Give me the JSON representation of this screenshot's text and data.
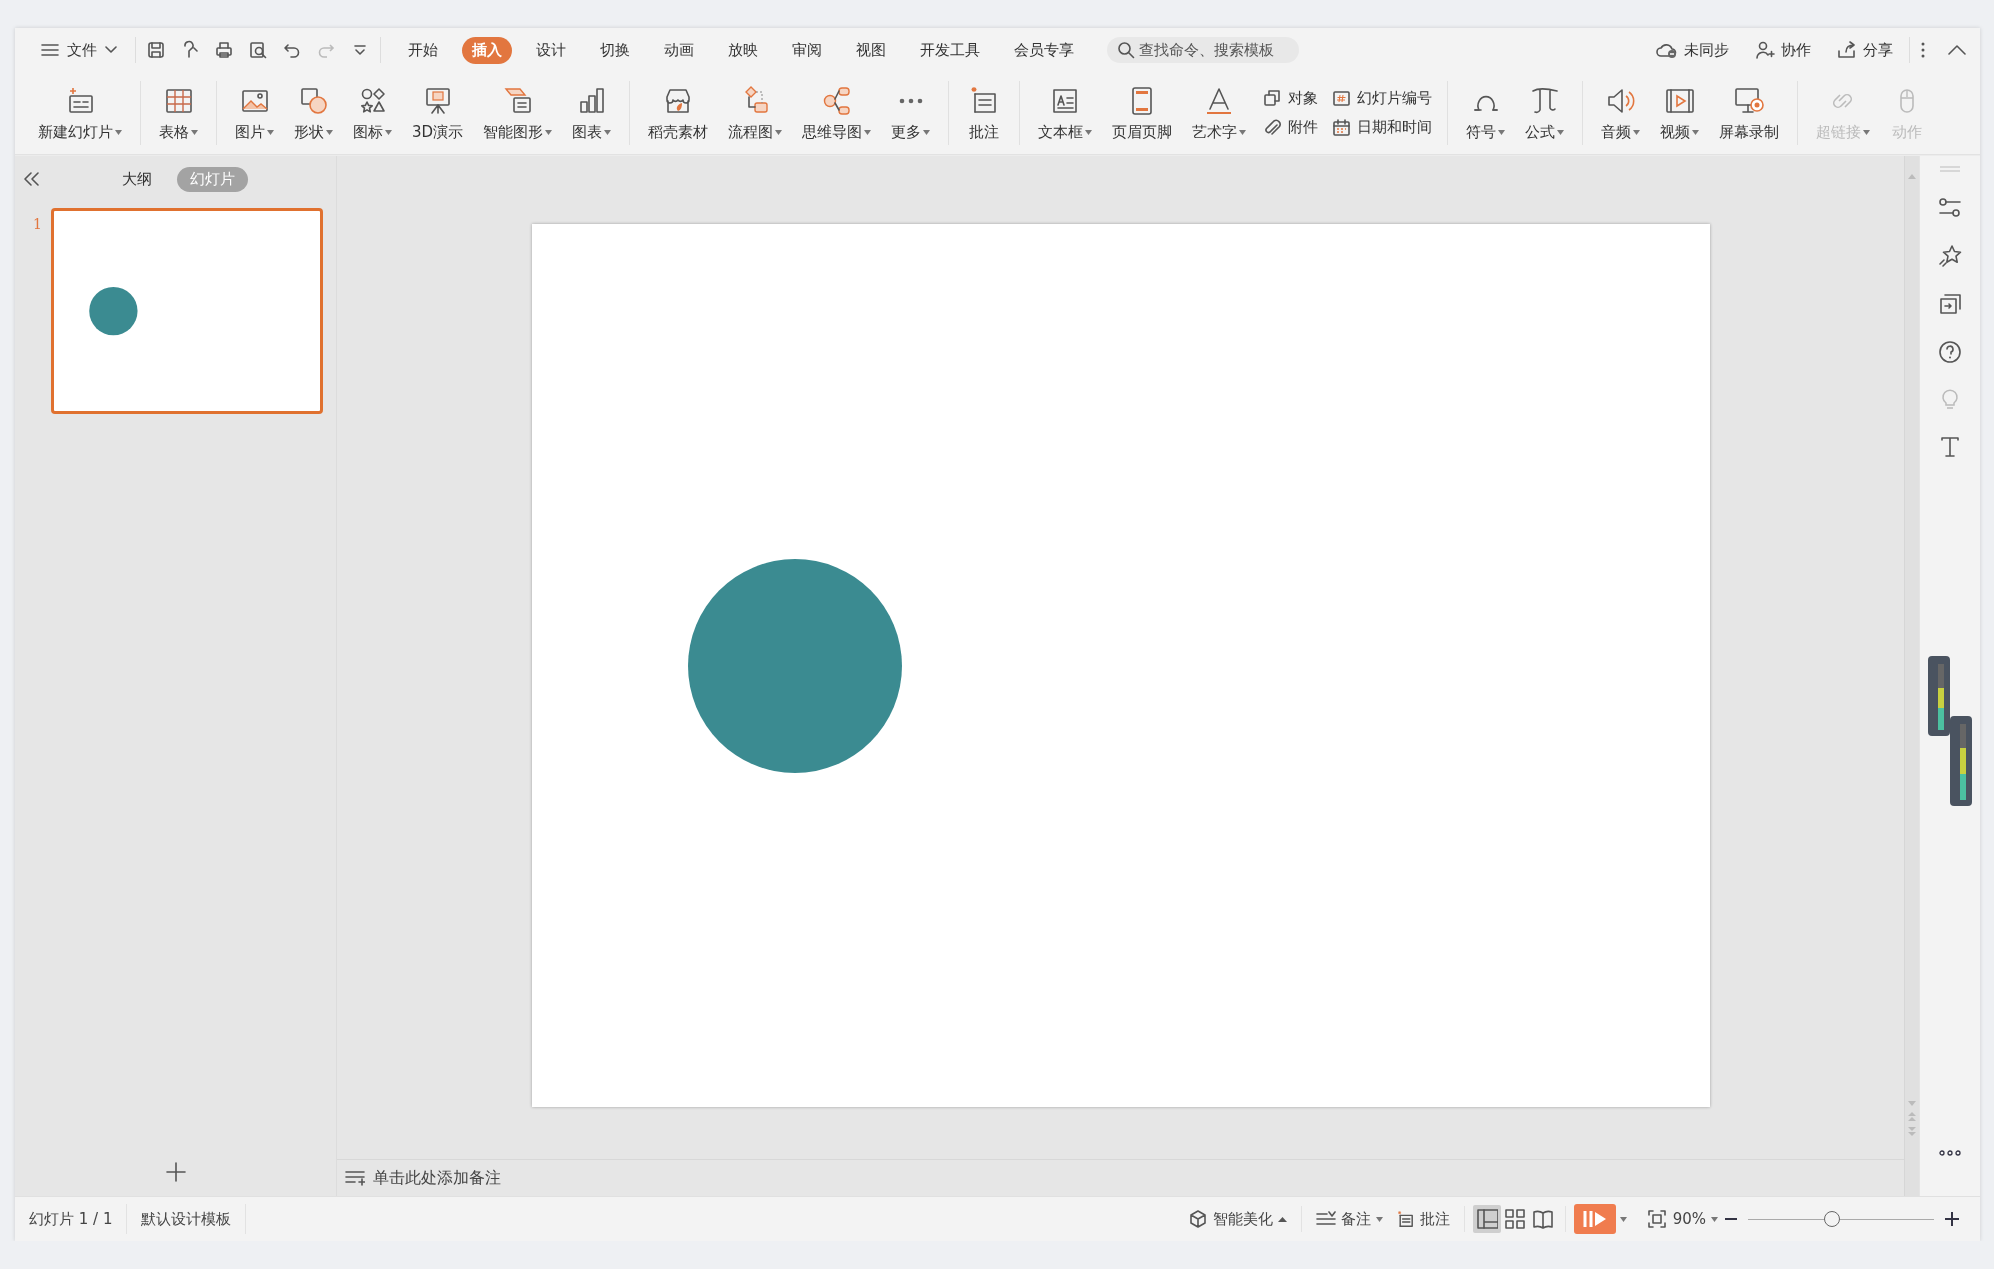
{
  "menu": {
    "file_label": "文件",
    "tabs": [
      {
        "label": "开始",
        "selected": false
      },
      {
        "label": "插入",
        "selected": true
      },
      {
        "label": "设计",
        "selected": false
      },
      {
        "label": "切换",
        "selected": false
      },
      {
        "label": "动画",
        "selected": false
      },
      {
        "label": "放映",
        "selected": false
      },
      {
        "label": "审阅",
        "selected": false
      },
      {
        "label": "视图",
        "selected": false
      },
      {
        "label": "开发工具",
        "selected": false
      },
      {
        "label": "会员专享",
        "selected": false
      }
    ],
    "search": {
      "placeholder": "查找命令、搜索模板"
    },
    "actions": [
      "未同步",
      "协作",
      "分享"
    ]
  },
  "ribbon": {
    "groups": [
      {
        "items": [
          {
            "kind": "large",
            "label": "新建幻灯片",
            "dropdown": true,
            "disabled": false
          }
        ]
      },
      {
        "items": [
          {
            "kind": "large",
            "label": "表格",
            "dropdown": true,
            "disabled": false
          }
        ]
      },
      {
        "items": [
          {
            "kind": "large",
            "label": "图片",
            "dropdown": true,
            "disabled": false
          },
          {
            "kind": "large",
            "label": "形状",
            "dropdown": true,
            "disabled": false
          },
          {
            "kind": "large",
            "label": "图标",
            "dropdown": true,
            "disabled": false
          },
          {
            "kind": "large",
            "label": "3D演示",
            "dropdown": false,
            "disabled": false
          },
          {
            "kind": "large",
            "label": "智能图形",
            "dropdown": true,
            "disabled": false
          },
          {
            "kind": "large",
            "label": "图表",
            "dropdown": true,
            "disabled": false
          }
        ]
      },
      {
        "items": [
          {
            "kind": "large",
            "label": "稻壳素材",
            "dropdown": false,
            "disabled": false
          },
          {
            "kind": "large",
            "label": "流程图",
            "dropdown": true,
            "disabled": false
          },
          {
            "kind": "large",
            "label": "思维导图",
            "dropdown": true,
            "disabled": false
          },
          {
            "kind": "large",
            "label": "更多",
            "dropdown": true,
            "disabled": false
          }
        ]
      },
      {
        "items": [
          {
            "kind": "large",
            "label": "批注",
            "dropdown": false,
            "disabled": false
          }
        ]
      },
      {
        "items": [
          {
            "kind": "large",
            "label": "文本框",
            "dropdown": true,
            "disabled": false
          },
          {
            "kind": "large",
            "label": "页眉页脚",
            "dropdown": false,
            "disabled": false
          },
          {
            "kind": "large",
            "label": "艺术字",
            "dropdown": true,
            "disabled": false
          },
          {
            "kind": "stack",
            "top": "对象",
            "bottom": "附件"
          },
          {
            "kind": "stack",
            "top": "幻灯片编号",
            "bottom": "日期和时间"
          }
        ]
      },
      {
        "items": [
          {
            "kind": "large",
            "label": "符号",
            "dropdown": true,
            "disabled": false
          },
          {
            "kind": "large",
            "label": "公式",
            "dropdown": true,
            "disabled": false
          }
        ]
      },
      {
        "items": [
          {
            "kind": "large",
            "label": "音频",
            "dropdown": true,
            "disabled": false
          },
          {
            "kind": "large",
            "label": "视频",
            "dropdown": true,
            "disabled": false
          },
          {
            "kind": "large",
            "label": "屏幕录制",
            "dropdown": false,
            "disabled": false
          }
        ]
      },
      {
        "items": [
          {
            "kind": "large",
            "label": "超链接",
            "dropdown": true,
            "disabled": true
          },
          {
            "kind": "large",
            "label": "动作",
            "dropdown": false,
            "disabled": true
          }
        ]
      }
    ]
  },
  "panel": {
    "tabs": [
      {
        "label": "大纲",
        "selected": false
      },
      {
        "label": "幻灯片",
        "selected": true
      }
    ],
    "slides": [
      {
        "number": "1",
        "selected": true
      }
    ]
  },
  "slide": {
    "shapes": [
      {
        "kind": "circle"
      }
    ]
  },
  "notes": {
    "placeholder": "单击此处添加备注"
  },
  "status_bar": {
    "left": [
      "幻灯片 1 / 1",
      "默认设计模板"
    ],
    "beautify": "智能美化",
    "notes": "备注",
    "comments": "批注",
    "views": [
      {
        "selected": true
      },
      {
        "selected": false
      },
      {
        "selected": false
      }
    ],
    "zoom": "90%",
    "zoom_slider": {
      "level": 0.45
    }
  }
}
